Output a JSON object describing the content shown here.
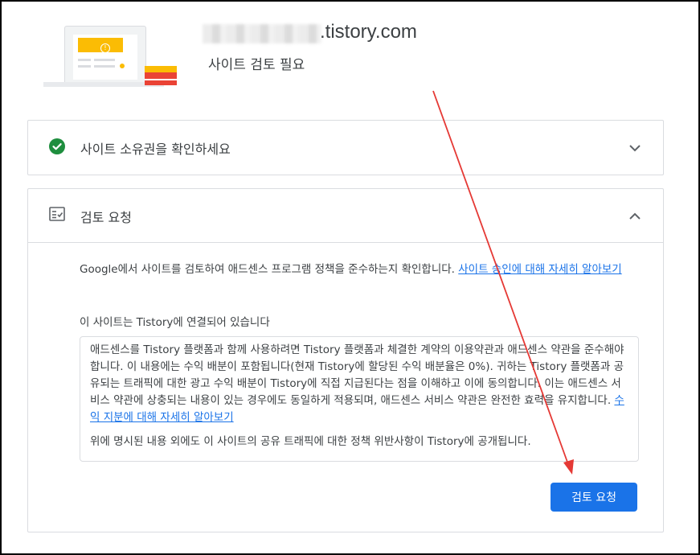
{
  "header": {
    "domain_suffix": ".tistory.com",
    "status": "사이트 검토 필요"
  },
  "ownership_card": {
    "title": "사이트 소유권을 확인하세요"
  },
  "review_card": {
    "title": "검토 요청",
    "intro_text": "Google에서 사이트를 검토하여 애드센스 프로그램 정책을 준수하는지 확인합니다. ",
    "intro_link": "사이트 승인에 대해 자세히 알아보기",
    "connected_text": "이 사이트는 Tistory에 연결되어 있습니다",
    "terms_paragraph_1": "애드센스를 Tistory 플랫폼과 함께 사용하려면 Tistory 플랫폼과 체결한 계약의 이용약관과 애드센스 약관을 준수해야 합니다. 이 내용에는 수익 배분이 포함됩니다(현재 Tistory에 할당된 수익 배분율은 0%). 귀하는 Tistory 플랫폼과 공유되는 트래픽에 대한 광고 수익 배분이 Tistory에 직접 지급된다는 점을 이해하고 이에 동의합니다. 이는 애드센스 서비스 약관에 상충되는 내용이 있는 경우에도 동일하게 적용되며, 애드센스 서비스 약관은 완전한 효력을 유지합니다. ",
    "terms_link": "수익 지분에 대해 자세히 알아보기",
    "terms_paragraph_2": "위에 명시된 내용 외에도 이 사이트의 공유 트래픽에 대한 정책 위반사항이 Tistory에 공개됩니다.",
    "submit_label": "검토 요청"
  },
  "colors": {
    "accent": "#1a73e8",
    "success": "#1e8e3e",
    "annotation_arrow": "#e53935"
  },
  "icons": {
    "ownership": "check-circle-icon",
    "review": "checklist-icon",
    "collapsed": "chevron-down-icon",
    "expanded": "chevron-up-icon"
  }
}
